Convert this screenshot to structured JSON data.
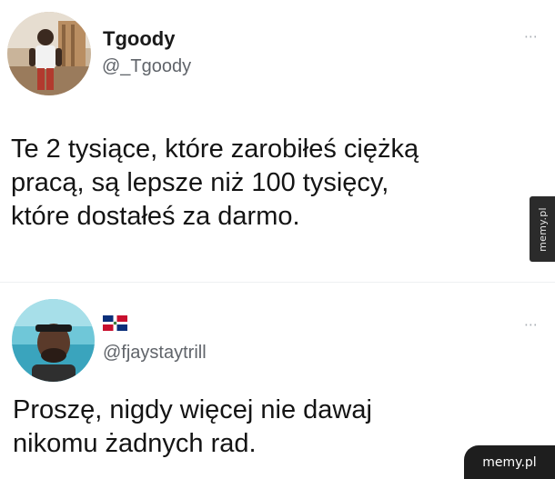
{
  "tweet1": {
    "display_name": "Tgoody",
    "handle": "@_Tgoody",
    "more_icon": "⋯",
    "avatar_icon": "profile-photo",
    "lines": [
      "Te 2 tysiące, które zarobiłeś ciężką",
      "pracą, są lepsze niż 100 tysięcy,",
      "które dostałeś za darmo."
    ]
  },
  "tweet2": {
    "flag_icon": "dominican-republic-flag",
    "handle": "@fjaystaytrill",
    "more_icon": "⋯",
    "avatar_icon": "profile-photo",
    "lines": [
      "Proszę, nigdy więcej nie dawaj",
      "nikomu żadnych rad."
    ]
  },
  "watermarks": {
    "side": "memy.pl",
    "corner": "memy.pl"
  },
  "colors": {
    "text": "#141414",
    "handle": "#60646a",
    "watermark_bg": "#1e1e1e"
  }
}
